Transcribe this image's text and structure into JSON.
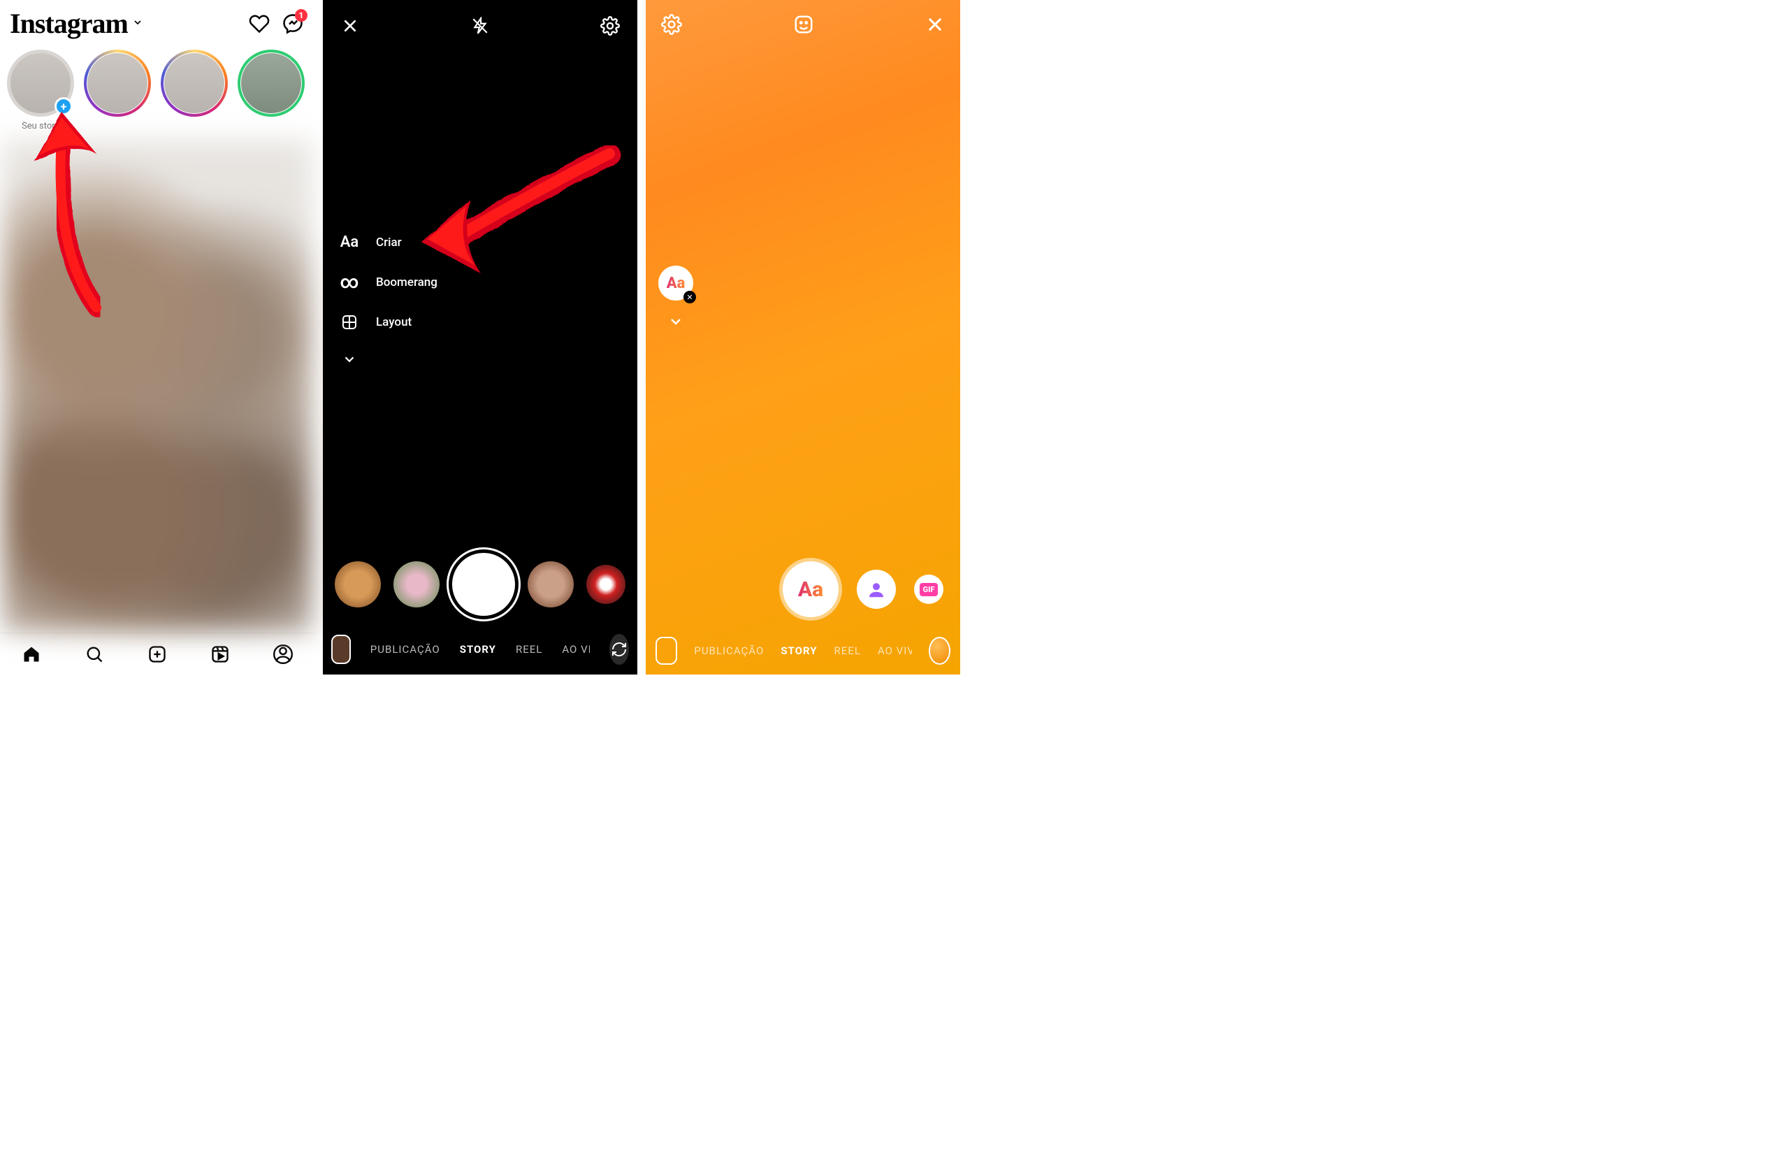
{
  "panel1": {
    "logo": "Instagram",
    "badge_count": "1",
    "your_story_label": "Seu story"
  },
  "panel2": {
    "tools": {
      "criar_icon": "Aa",
      "criar": "Criar",
      "boomerang_icon": "∞",
      "boomerang": "Boomerang",
      "layout": "Layout"
    },
    "modes": {
      "publicacao": "PUBLICAÇÃO",
      "story": "STORY",
      "reel": "REEL",
      "aovivo": "AO VIVO"
    }
  },
  "panel3": {
    "aa_label": "Aa",
    "main_label": "Aa",
    "gif_label": "GIF",
    "modes": {
      "publicacao": "PUBLICAÇÃO",
      "story": "STORY",
      "reel": "REEL",
      "aovivo": "AO VIVO"
    }
  }
}
